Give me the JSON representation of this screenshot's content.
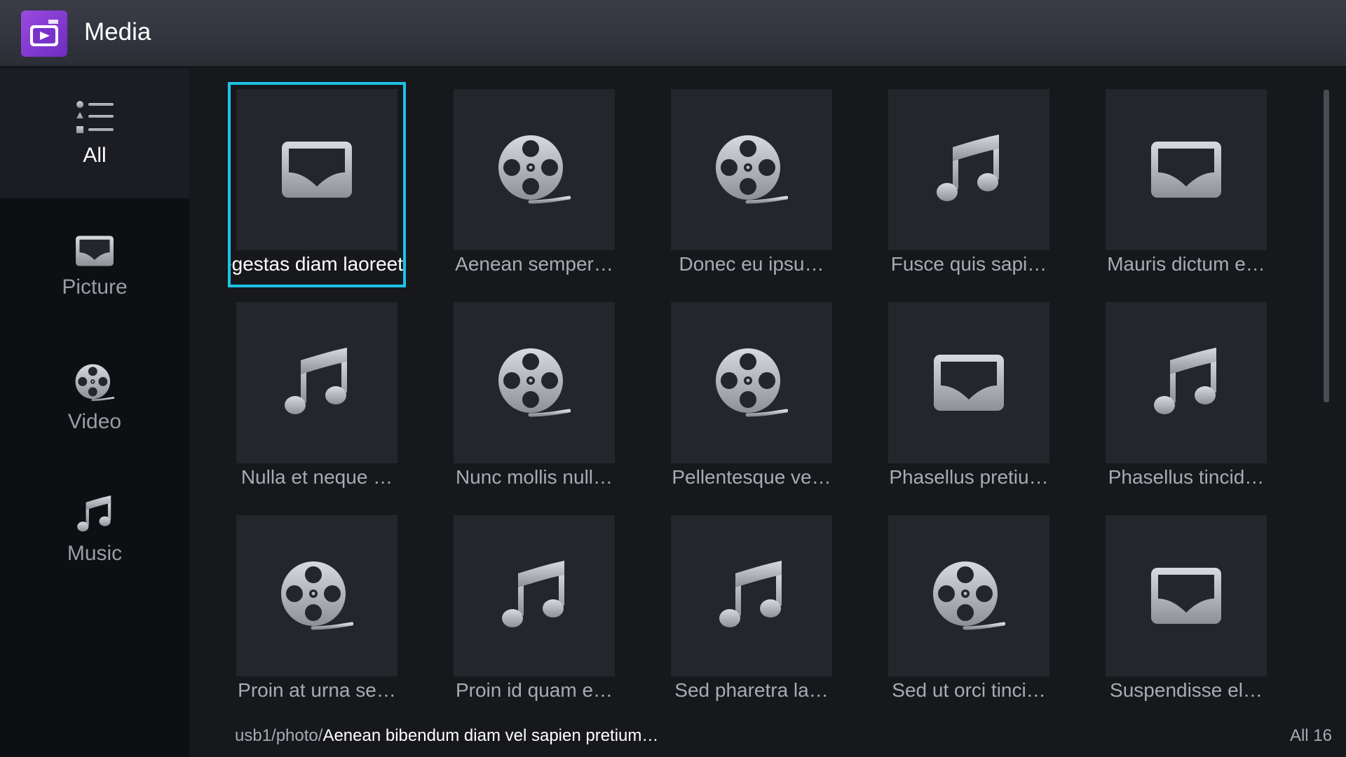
{
  "app": {
    "title": "Media",
    "icon": "media-app-icon",
    "accent": "#8a3ed6"
  },
  "sidebar": {
    "items": [
      {
        "label": "All",
        "icon": "list-icon",
        "active": true
      },
      {
        "label": "Picture",
        "icon": "picture-icon",
        "active": false
      },
      {
        "label": "Video",
        "icon": "film-reel-icon",
        "active": false
      },
      {
        "label": "Music",
        "icon": "music-note-icon",
        "active": false
      }
    ]
  },
  "grid": {
    "focus_color": "#1cc3e6",
    "items": [
      {
        "type": "picture",
        "icon": "picture-icon",
        "label": "egestas diam laoreet",
        "selected": true
      },
      {
        "type": "video",
        "icon": "film-reel-icon",
        "label": "Aenean semper…",
        "selected": false
      },
      {
        "type": "video",
        "icon": "film-reel-icon",
        "label": "Donec eu ipsu…",
        "selected": false
      },
      {
        "type": "music",
        "icon": "music-note-icon",
        "label": "Fusce quis sapi…",
        "selected": false
      },
      {
        "type": "picture",
        "icon": "picture-icon",
        "label": "Mauris dictum e…",
        "selected": false
      },
      {
        "type": "music",
        "icon": "music-note-icon",
        "label": "Nulla et neque …",
        "selected": false
      },
      {
        "type": "video",
        "icon": "film-reel-icon",
        "label": "Nunc mollis null…",
        "selected": false
      },
      {
        "type": "video",
        "icon": "film-reel-icon",
        "label": "Pellentesque ve…",
        "selected": false
      },
      {
        "type": "picture",
        "icon": "picture-icon",
        "label": "Phasellus pretiu…",
        "selected": false
      },
      {
        "type": "music",
        "icon": "music-note-icon",
        "label": "Phasellus tincid…",
        "selected": false
      },
      {
        "type": "video",
        "icon": "film-reel-icon",
        "label": "Proin at urna se…",
        "selected": false
      },
      {
        "type": "music",
        "icon": "music-note-icon",
        "label": "Proin id quam e…",
        "selected": false
      },
      {
        "type": "music",
        "icon": "music-note-icon",
        "label": "Sed pharetra la…",
        "selected": false
      },
      {
        "type": "video",
        "icon": "film-reel-icon",
        "label": "Sed ut orci tinci…",
        "selected": false
      },
      {
        "type": "picture",
        "icon": "picture-icon",
        "label": "Suspendisse el…",
        "selected": false
      }
    ]
  },
  "footer": {
    "path_prefix": "usb1/photo/",
    "path_file": "Aenean bibendum diam vel sapien pretium…",
    "count": "All 16"
  }
}
